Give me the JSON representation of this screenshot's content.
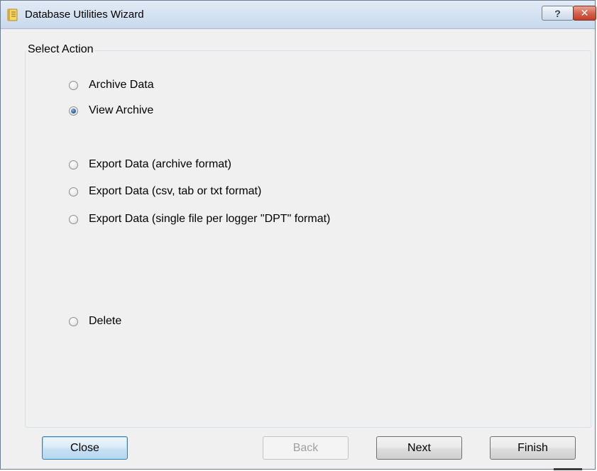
{
  "window": {
    "title": "Database Utilities Wizard",
    "help_glyph": "?",
    "close_glyph": "✕"
  },
  "group": {
    "label": "Select Action"
  },
  "options": [
    {
      "label": "Archive Data",
      "checked": false
    },
    {
      "label": "View Archive",
      "checked": true
    },
    {
      "label": "Export Data (archive format)",
      "checked": false
    },
    {
      "label": "Export Data (csv, tab or txt  format)",
      "checked": false
    },
    {
      "label": "Export Data (single file per logger \"DPT\" format)",
      "checked": false
    },
    {
      "label": "Delete",
      "checked": false
    }
  ],
  "buttons": {
    "close": "Close",
    "back": "Back",
    "next": "Next",
    "finish": "Finish"
  },
  "icons": {
    "app": "notebook-icon",
    "help": "help-icon",
    "close": "close-icon"
  },
  "colors": {
    "window_bg": "#f0f0f0",
    "titlebar": "#d6e3f2",
    "close_button": "#c24028",
    "default_button_border": "#3c7fb1",
    "radio_dot": "#2f5f9e"
  }
}
